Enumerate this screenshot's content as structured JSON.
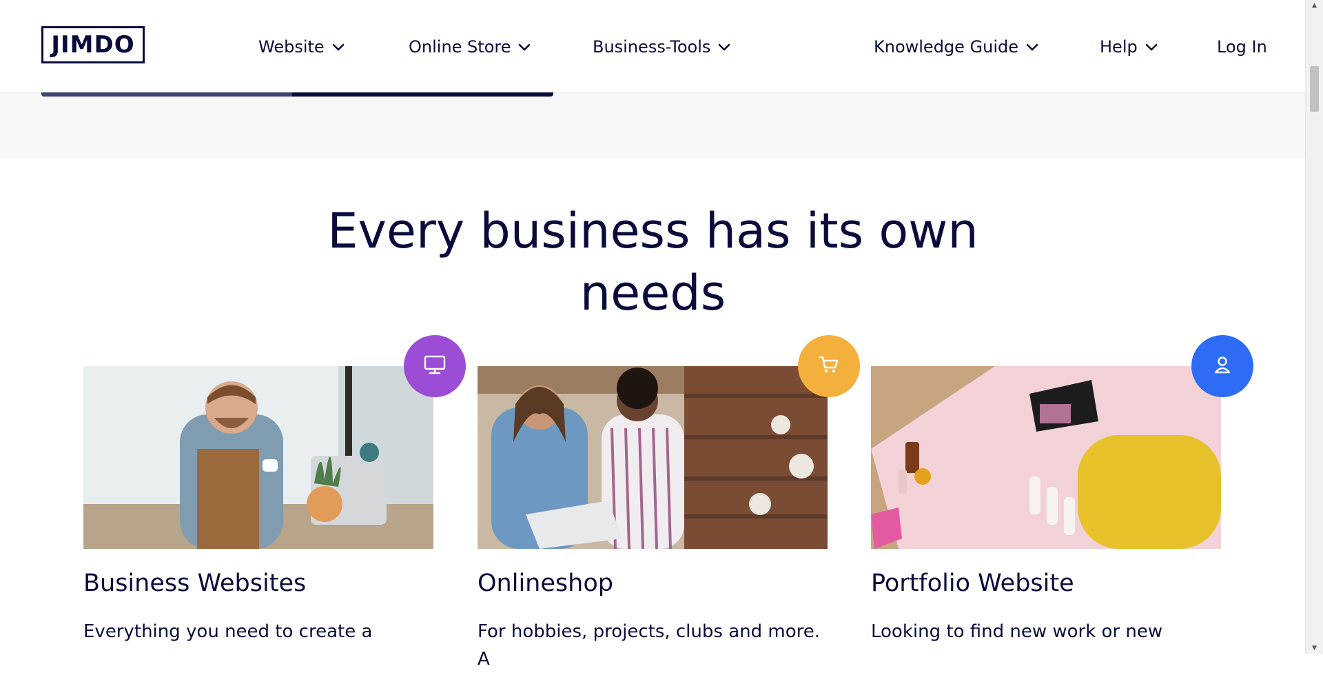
{
  "brand": {
    "logo_text": "JIMDO"
  },
  "nav": {
    "items": [
      {
        "label": "Website"
      },
      {
        "label": "Online Store"
      },
      {
        "label": "Business-Tools"
      },
      {
        "label": "Knowledge Guide"
      },
      {
        "label": "Help"
      }
    ],
    "login_label": "Log In"
  },
  "section": {
    "title": "Every business has its own needs"
  },
  "cards": [
    {
      "title": "Business Websites",
      "text": "Everything you need to create a",
      "icon": "monitor-icon",
      "badge_color": "#9b4dd6"
    },
    {
      "title": "Onlineshop",
      "text": "For hobbies, projects, clubs and more. A",
      "icon": "cart-icon",
      "badge_color": "#f4b03d"
    },
    {
      "title": "Portfolio Website",
      "text": "Looking to find new work or new",
      "icon": "person-icon",
      "badge_color": "#2f6cf6"
    }
  ],
  "colors": {
    "navy": "#0b0b3b",
    "band_gray": "#f7f7f8"
  }
}
